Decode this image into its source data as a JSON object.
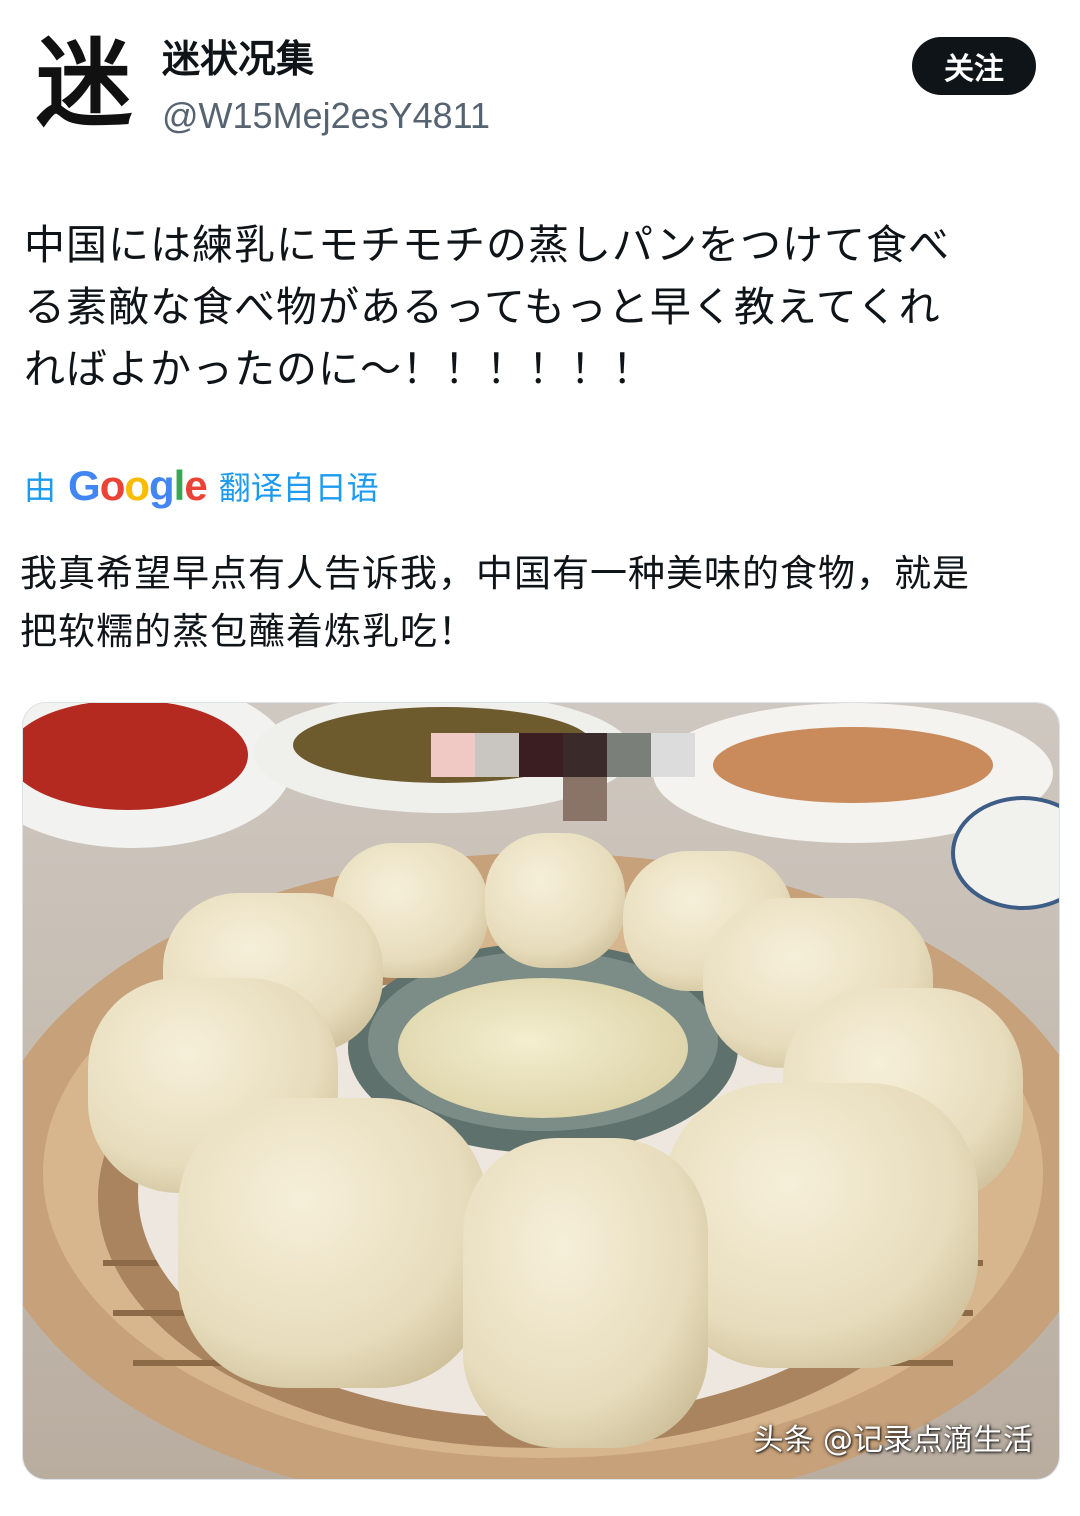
{
  "author": {
    "avatar_char": "迷",
    "display_name": "迷状况集",
    "handle": "@W15Mej2esY4811"
  },
  "follow_label": "关注",
  "tweet": {
    "original_line1": "中国には練乳にモチモチの蒸しパンをつけて食べ",
    "original_line2": "る素敵な食べ物があるってもっと早く教えてくれ",
    "original_line3": "ればよかったのに～！！！！！！",
    "translate_prefix": "由",
    "translate_suffix": "翻译自日语",
    "translated_line1": "我真希望早点有人告诉我，中国有一种美味的食物，就是",
    "translated_line2": "把软糯的蒸包蘸着炼乳吃！"
  },
  "google_logo": {
    "letters": [
      "G",
      "o",
      "o",
      "g",
      "l",
      "e"
    ]
  },
  "watermark": "头条 @记录点滴生活"
}
